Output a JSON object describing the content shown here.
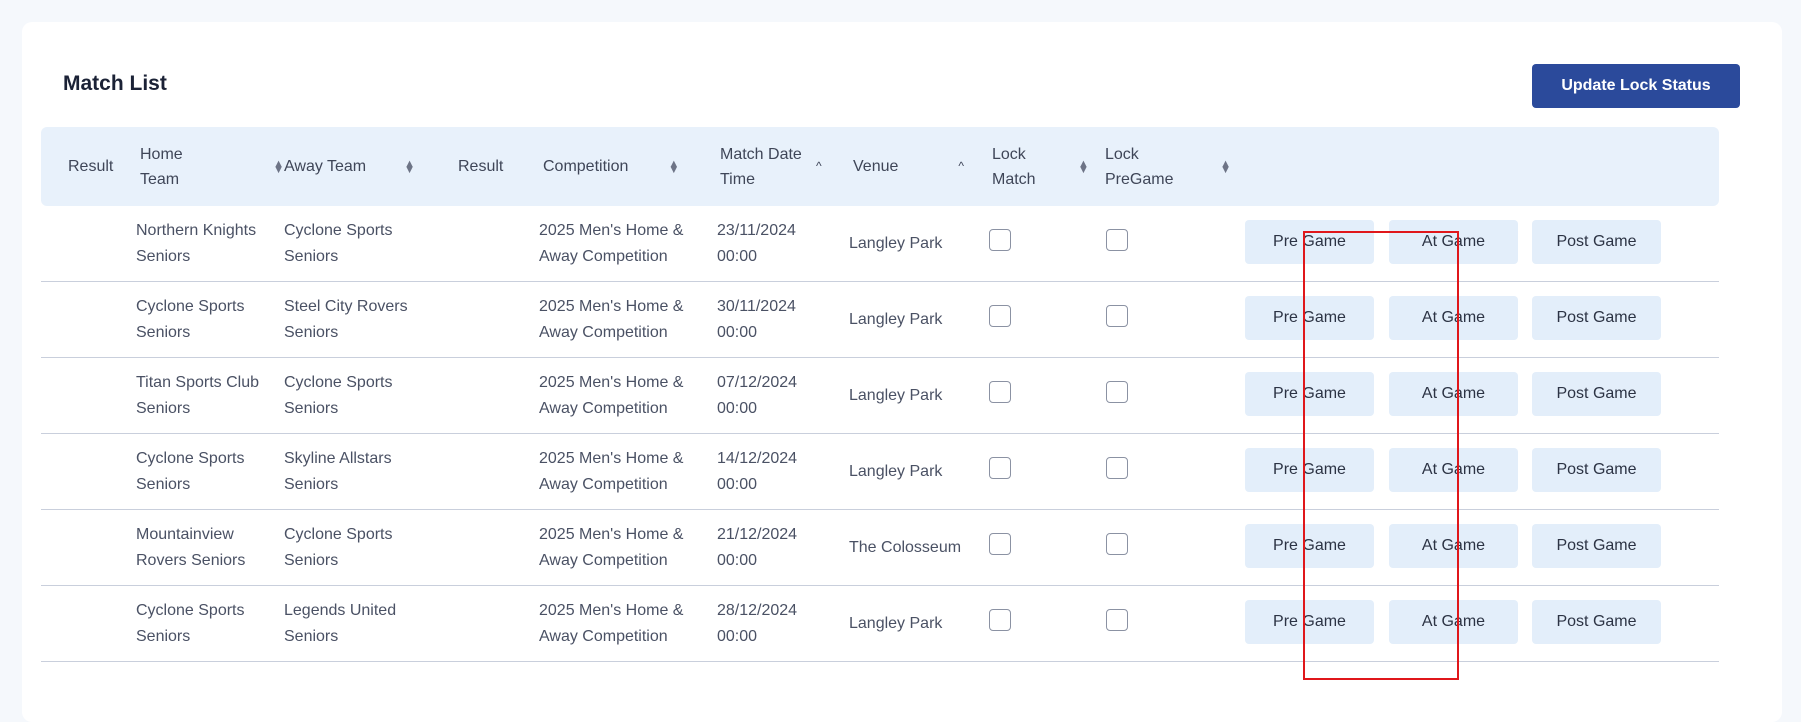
{
  "page": {
    "title": "Match List",
    "update_button": "Update Lock Status"
  },
  "table": {
    "headers": {
      "result1": "Result",
      "home": "Home Team",
      "away": "Away Team",
      "result2": "Result",
      "competition": "Competition",
      "datetime": "Match Date Time",
      "venue": "Venue",
      "lock_match": "Lock Match",
      "lock_pregame": "Lock PreGame"
    },
    "rows": [
      {
        "result1": "",
        "home": "Northern Knights Seniors",
        "away": "Cyclone Sports Seniors",
        "result2": "",
        "competition": "2025 Men's Home & Away Competition",
        "datetime": "23/11/2024 00:00",
        "venue": "Langley Park",
        "pre": "Pre Game",
        "at": "At Game",
        "post": "Post Game"
      },
      {
        "result1": "",
        "home": "Cyclone Sports Seniors",
        "away": "Steel City Rovers Seniors",
        "result2": "",
        "competition": "2025 Men's Home & Away Competition",
        "datetime": "30/11/2024 00:00",
        "venue": "Langley Park",
        "pre": "Pre Game",
        "at": "At Game",
        "post": "Post Game"
      },
      {
        "result1": "",
        "home": "Titan Sports Club Seniors",
        "away": "Cyclone Sports Seniors",
        "result2": "",
        "competition": "2025 Men's Home & Away Competition",
        "datetime": "07/12/2024 00:00",
        "venue": "Langley Park",
        "pre": "Pre Game",
        "at": "At Game",
        "post": "Post Game"
      },
      {
        "result1": "",
        "home": "Cyclone Sports Seniors",
        "away": "Skyline Allstars Seniors",
        "result2": "",
        "competition": "2025 Men's Home & Away Competition",
        "datetime": "14/12/2024 00:00",
        "venue": "Langley Park",
        "pre": "Pre Game",
        "at": "At Game",
        "post": "Post Game"
      },
      {
        "result1": "",
        "home": "Mountainview Rovers Seniors",
        "away": "Cyclone Sports Seniors",
        "result2": "",
        "competition": "2025 Men's Home & Away Competition",
        "datetime": "21/12/2024 00:00",
        "venue": "The Colosseum",
        "pre": "Pre Game",
        "at": "At Game",
        "post": "Post Game"
      },
      {
        "result1": "",
        "home": "Cyclone Sports Seniors",
        "away": "Legends United Seniors",
        "result2": "",
        "competition": "2025 Men's Home & Away Competition",
        "datetime": "28/12/2024 00:00",
        "venue": "Langley Park",
        "pre": "Pre Game",
        "at": "At Game",
        "post": "Post Game"
      }
    ]
  },
  "colors": {
    "primary_button": "#2b4a9b",
    "header_bg": "#e8f1fb",
    "action_button_bg": "#e3eefa",
    "highlight": "#e0171b"
  },
  "icons": {
    "sort": "sort-updown-icon",
    "sort_asc": "sort-asc-icon",
    "checkbox": "checkbox-unchecked-icon"
  }
}
